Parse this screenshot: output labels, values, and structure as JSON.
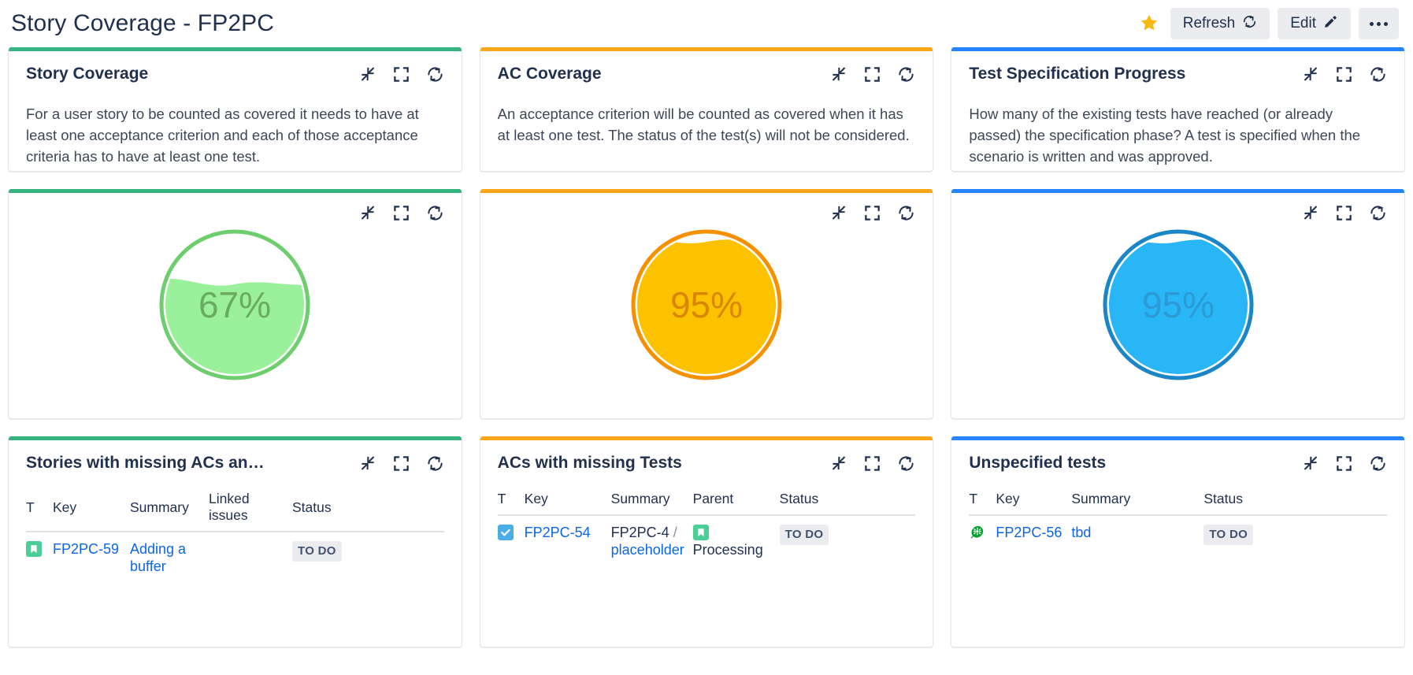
{
  "header": {
    "title": "Story Coverage - FP2PC",
    "star_icon": "star-icon",
    "refresh_label": "Refresh",
    "refresh_icon": "refresh-icon",
    "edit_label": "Edit",
    "edit_icon": "pencil-icon",
    "more_icon": "more-options-icon"
  },
  "colors": {
    "accent_green": "#36b37e",
    "accent_orange": "#faa61a",
    "accent_blue": "#2684ff",
    "gauge_green_stroke": "#6ece6e",
    "gauge_green_fill": "#9bf09b",
    "gauge_orange_stroke": "#f59100",
    "gauge_orange_fill": "#fcc200",
    "gauge_blue_stroke": "#1a86c8",
    "gauge_blue_fill": "#29b6f6",
    "link": "#0c66e4",
    "text": "#21314d"
  },
  "tools": {
    "collapse_icon": "collapse-icon",
    "fullscreen_icon": "fullscreen-icon",
    "refresh_icon": "refresh-icon"
  },
  "cards": {
    "story_coverage_desc": {
      "title": "Story Coverage",
      "description": "For a user story to be counted as covered it needs to have at least one acceptance criterion and each of those acceptance criteria has to have at least one test."
    },
    "ac_coverage_desc": {
      "title": "AC Coverage",
      "description": "An acceptance criterion will be counted as covered when it has at least one test. The status of the test(s) will not be considered."
    },
    "test_spec_desc": {
      "title": "Test Specification Progress",
      "description": "How many of the existing tests have reached (or already passed) the specification phase? A test is specified when the scenario is written and was approved."
    }
  },
  "chart_data": [
    {
      "type": "gauge",
      "name": "story-coverage-gauge",
      "title": "Story Coverage",
      "value": 67,
      "label": "67%",
      "unit": "%",
      "ylim": [
        0,
        100
      ],
      "style": "liquid-fill",
      "stroke": "#6ece6e",
      "fill": "#9bf09b",
      "text_color": "#6aab62"
    },
    {
      "type": "gauge",
      "name": "ac-coverage-gauge",
      "title": "AC Coverage",
      "value": 95,
      "label": "95%",
      "unit": "%",
      "ylim": [
        0,
        100
      ],
      "style": "liquid-fill",
      "stroke": "#f59100",
      "fill": "#fcc200",
      "text_color": "#d98600"
    },
    {
      "type": "gauge",
      "name": "test-specification-progress-gauge",
      "title": "Test Specification Progress",
      "value": 95,
      "label": "95%",
      "unit": "%",
      "ylim": [
        0,
        100
      ],
      "style": "liquid-fill",
      "stroke": "#1a86c8",
      "fill": "#29b6f6",
      "text_color": "#2c9ad6"
    }
  ],
  "tables": {
    "stories_missing": {
      "title": "Stories with missing ACs an…",
      "columns": [
        "T",
        "Key",
        "Summary",
        "Linked issues",
        "Status"
      ],
      "rows": [
        {
          "type_icon": "story-icon",
          "key": "FP2PC-59",
          "summary": "Adding a buffer",
          "linked": "",
          "status": "TO DO"
        }
      ]
    },
    "acs_missing_tests": {
      "title": "ACs with missing Tests",
      "columns": [
        "T",
        "Key",
        "Summary",
        "Parent",
        "Status"
      ],
      "rows": [
        {
          "type_icon": "task-icon",
          "key": "FP2PC-54",
          "summary_prefix": "FP2PC-4",
          "summary_sep": "/",
          "summary_link": "placeholder",
          "parent_icon": "story-icon",
          "parent": "Processing",
          "status": "TO DO"
        }
      ]
    },
    "unspecified_tests": {
      "title": "Unspecified tests",
      "columns": [
        "T",
        "Key",
        "Summary",
        "Status"
      ],
      "rows": [
        {
          "type_icon": "cucumber-test-icon",
          "key": "FP2PC-56",
          "summary": "tbd",
          "status": "TO DO"
        }
      ]
    }
  }
}
